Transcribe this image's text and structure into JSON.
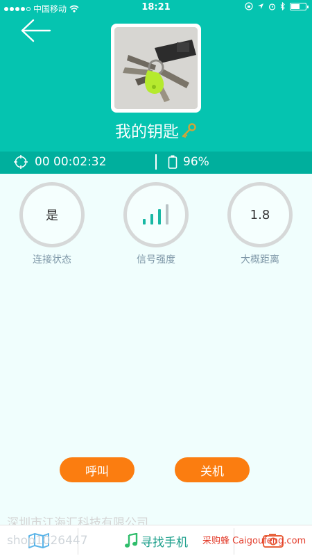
{
  "status_bar": {
    "carrier": "中国移动",
    "time": "18:21"
  },
  "device": {
    "name": "我的钥匙"
  },
  "info": {
    "timer": "00 00:02:32",
    "battery": "96%"
  },
  "gauges": [
    {
      "value": "是",
      "label": "连接状态"
    },
    {
      "value": "",
      "label": "信号强度",
      "signal_bars": 4,
      "signal_bars_active": 3
    },
    {
      "value": "1.8",
      "label": "大概距离"
    }
  ],
  "actions": {
    "call_label": "呼叫",
    "power_off_label": "关机"
  },
  "tabbar": {
    "find_phone_label": "寻找手机"
  },
  "watermarks": {
    "company": "深圳市江海汇科技有限公司",
    "site_partial": "shop1026447",
    "brand": "采购蜂 Caigoufeng.com"
  },
  "colors": {
    "header": "#05c4b0",
    "strip": "#00af9d",
    "accent_orange": "#fb7d10",
    "background": "#f0fefd"
  }
}
